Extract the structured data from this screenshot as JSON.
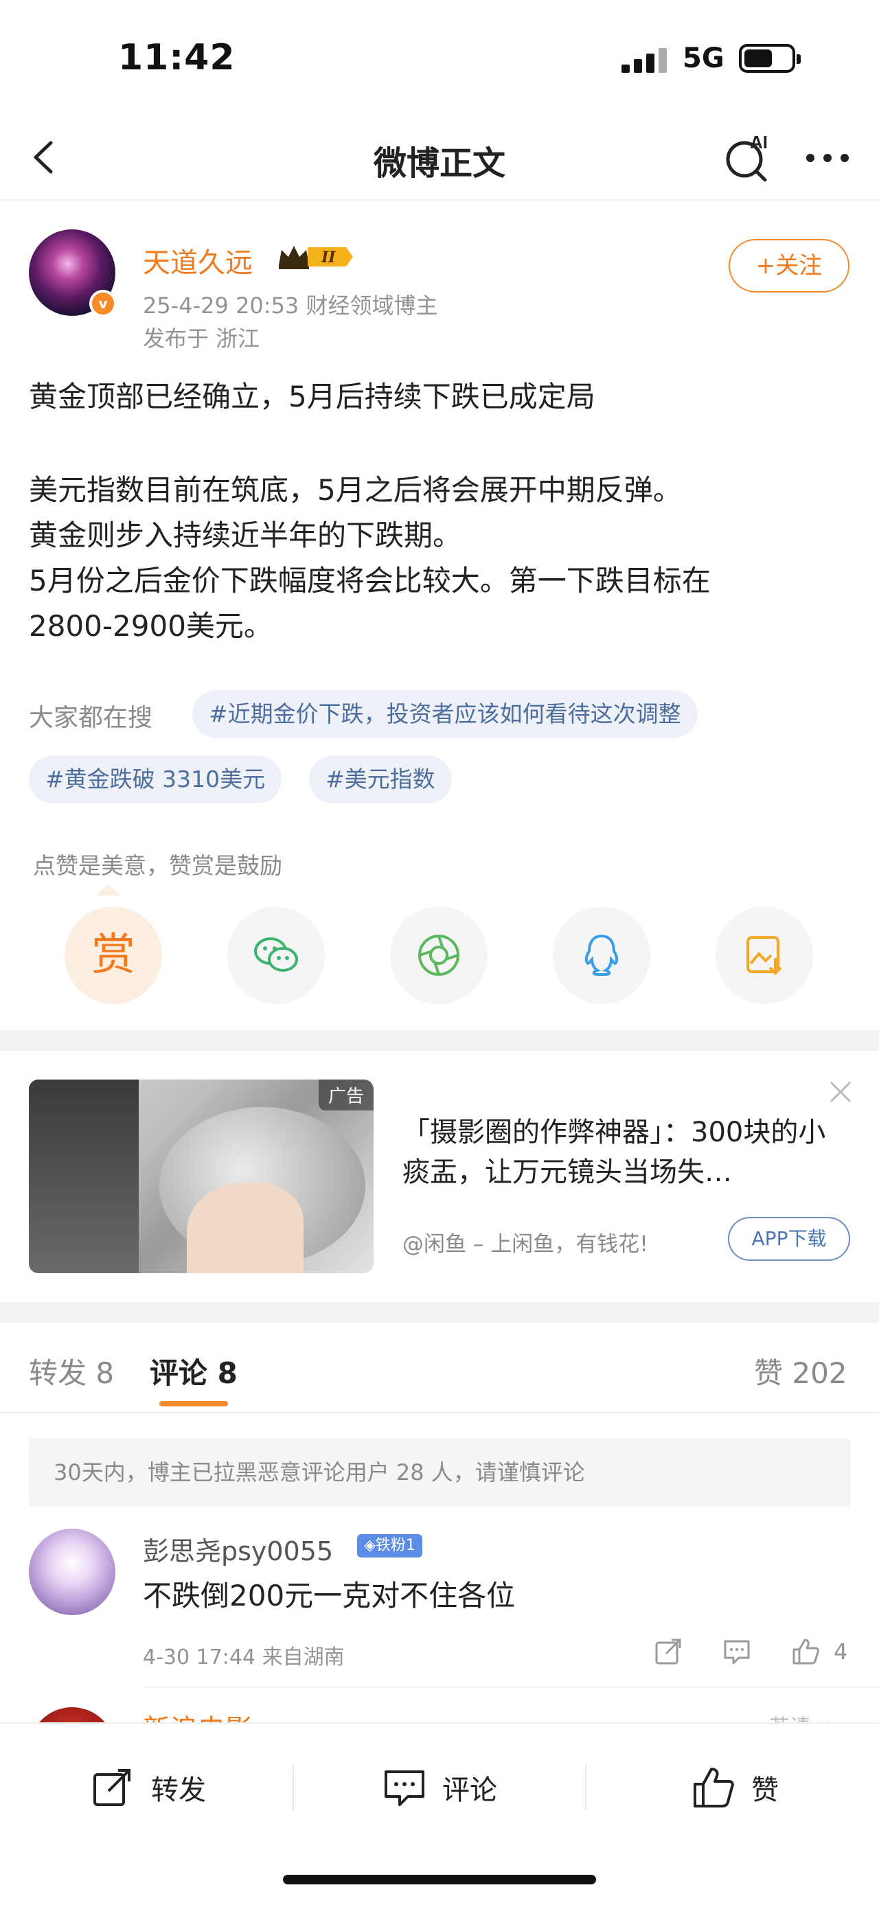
{
  "status_bar": {
    "time": "11:42",
    "network": "5G"
  },
  "nav": {
    "title": "微博正文",
    "ai_label": "AI"
  },
  "author": {
    "name": "天道久远",
    "meta": "25-4-29 20:53  财经领域博主",
    "location": "发布于 浙江",
    "follow_label": "+关注"
  },
  "post": {
    "line1": "黄金顶部已经确立，5月后持续下跌已成定局",
    "line2": "美元指数目前在筑底，5月之后将会展开中期反弹。",
    "line3": "黄金则步入持续近半年的下跌期。",
    "line4": "5月份之后金价下跌幅度将会比较大。第一下跌目标在",
    "line5": "2800-2900美元。"
  },
  "hot_search": {
    "label": "大家都在搜",
    "topics": [
      "#近期金价下跌，投资者应该如何看待这次调整",
      "#黄金跌破 3310美元",
      "#美元指数"
    ]
  },
  "reward": {
    "hint": "点赞是美意，赞赏是鼓励",
    "reward_char": "赏"
  },
  "ad": {
    "tag": "广告",
    "title": "「摄影圈的作弊神器」：300块的小痰盂，让万元镜头当场失…",
    "source": "@闲鱼 – 上闲鱼，有钱花!",
    "button": "APP下载"
  },
  "tabs": {
    "repost": "转发 8",
    "comment": "评论 8",
    "like": "赞 202"
  },
  "notice": "30天内，博主已拉黑恶意评论用户 28 人，请谨慎评论",
  "comment": {
    "name": "彭思尧psy0055",
    "badge": "◈铁粉1",
    "text": "不跌倒200元一克对不住各位",
    "meta": "4-30 17:44  来自湖南",
    "like_count": "4"
  },
  "next_comment": {
    "name": "新浪电影",
    "right_text": "若请 ∨"
  },
  "bottom": {
    "repost": "转发",
    "comment": "评论",
    "like": "赞"
  },
  "colors": {
    "accent": "#f07a1d",
    "topic_text": "#4d6e9c",
    "topic_bg": "#eef2f8"
  }
}
